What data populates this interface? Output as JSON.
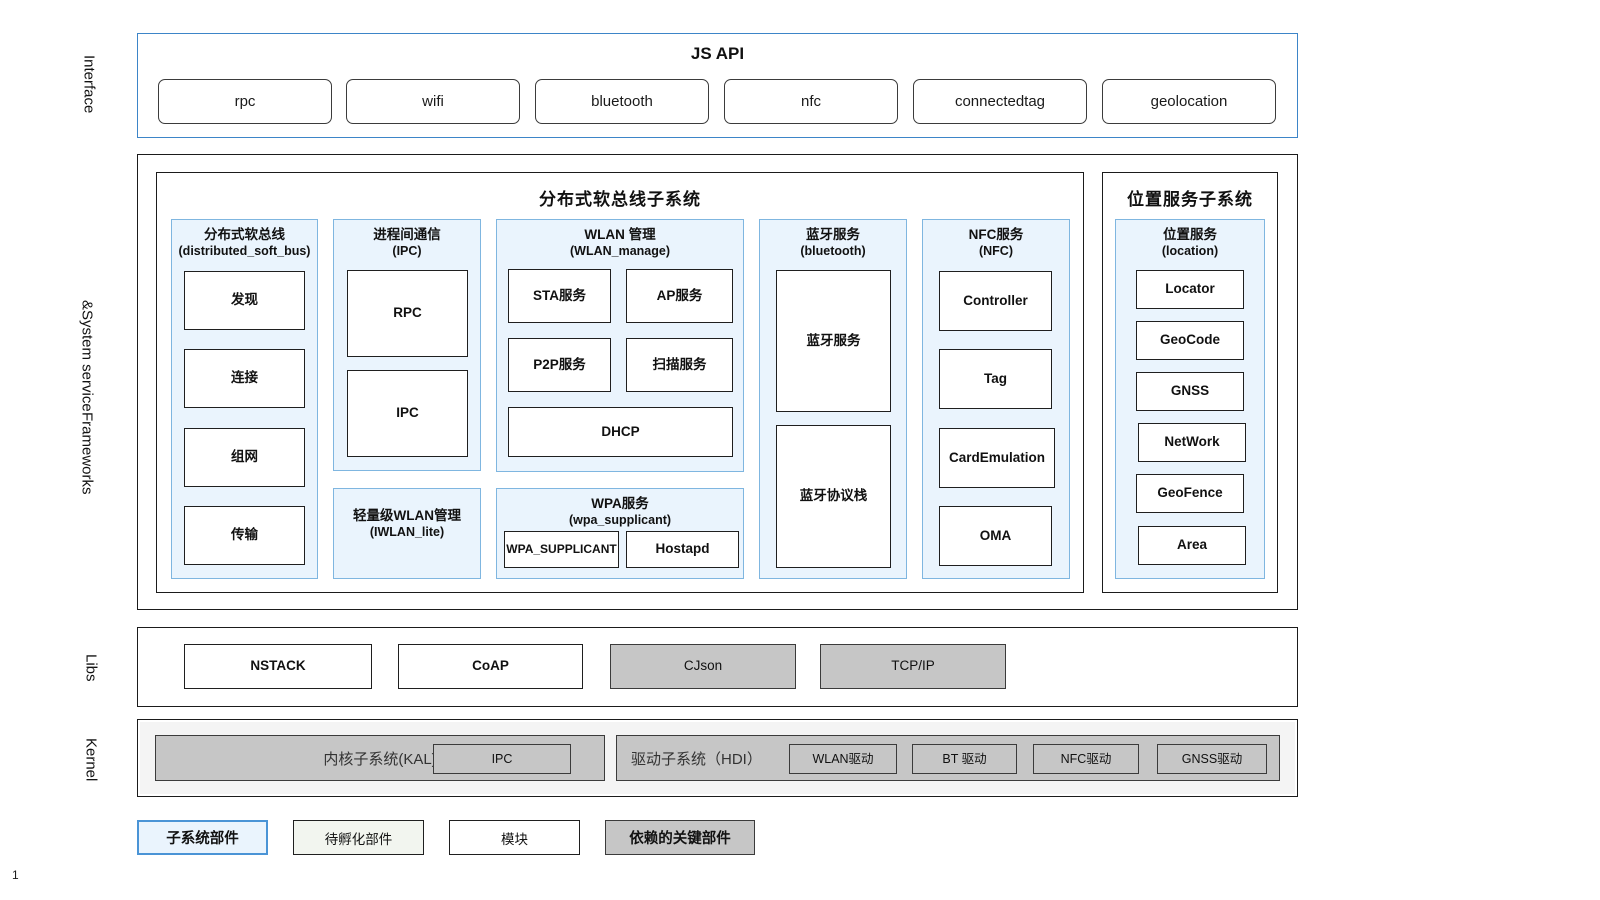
{
  "layers": {
    "interface": "Interface",
    "frameworks_line1": "Frameworks",
    "frameworks_line2": "&System service",
    "libs": "Libs",
    "kernel": "Kernel"
  },
  "jsapi": {
    "title": "JS API",
    "items": [
      {
        "label": "rpc"
      },
      {
        "label": "wifi"
      },
      {
        "label": "bluetooth"
      },
      {
        "label": "nfc"
      },
      {
        "label": "connectedtag"
      },
      {
        "label": "geolocation"
      }
    ]
  },
  "softbus_subsystem": {
    "title": "分布式软总线子系统",
    "components": {
      "dsb": {
        "name": "分布式软总线",
        "code": "(distributed_soft_bus)",
        "modules": [
          "发现",
          "连接",
          "组网",
          "传输"
        ]
      },
      "ipc": {
        "name": "进程间通信",
        "code": "(IPC)",
        "modules": [
          "RPC",
          "IPC"
        ]
      },
      "iwlan_lite": {
        "name": "轻量级WLAN管理",
        "code": "(IWLAN_lite)"
      },
      "wlan_manage": {
        "name": "WLAN 管理",
        "code": "(WLAN_manage)",
        "modules": [
          "STA服务",
          "AP服务",
          "P2P服务",
          "扫描服务",
          "DHCP"
        ]
      },
      "wpa": {
        "name": "WPA服务",
        "code": "(wpa_supplicant)",
        "modules": [
          "WPA_SUPPLICANT",
          "Hostapd"
        ]
      },
      "bluetooth": {
        "name": "蓝牙服务",
        "code": "(bluetooth)",
        "modules": [
          "蓝牙服务",
          "蓝牙协议栈"
        ]
      },
      "nfc": {
        "name": "NFC服务",
        "code": "(NFC)",
        "modules": [
          "Controller",
          "Tag",
          "CardEmulation",
          "OMA"
        ]
      }
    }
  },
  "location_subsystem": {
    "title": "位置服务子系统",
    "component": {
      "name": "位置服务",
      "code": "(location)",
      "modules": [
        "Locator",
        "GeoCode",
        "GNSS",
        "NetWork",
        "GeoFence",
        "Area"
      ]
    }
  },
  "libs": {
    "items": [
      {
        "label": "NSTACK",
        "style": "white"
      },
      {
        "label": "CoAP",
        "style": "white"
      },
      {
        "label": "CJson",
        "style": "gray"
      },
      {
        "label": "TCP/IP",
        "style": "gray"
      }
    ]
  },
  "kernel": {
    "kal": {
      "label": "内核子系统(KAL)",
      "modules": [
        "IPC"
      ]
    },
    "hdi": {
      "label": "驱动子系统（HDI）",
      "modules": [
        "WLAN驱动",
        "BT 驱动",
        "NFC驱动",
        "GNSS驱动"
      ]
    }
  },
  "legend": [
    {
      "label": "子系统部件",
      "style": "subsystem-component"
    },
    {
      "label": "待孵化部件",
      "style": "incubating-component"
    },
    {
      "label": "模块",
      "style": "module"
    },
    {
      "label": "依赖的关键部件",
      "style": "dependency-component"
    }
  ],
  "page_number": "1",
  "colors": {
    "accent_blue": "#3d85c8",
    "panel_blue": "#eaf4fd",
    "panel_border_blue": "#7fb6e0",
    "gray_fill": "#c6c6c6",
    "kernel_fill": "#f4f4f4",
    "incubating_fill": "#f2f5ef"
  }
}
